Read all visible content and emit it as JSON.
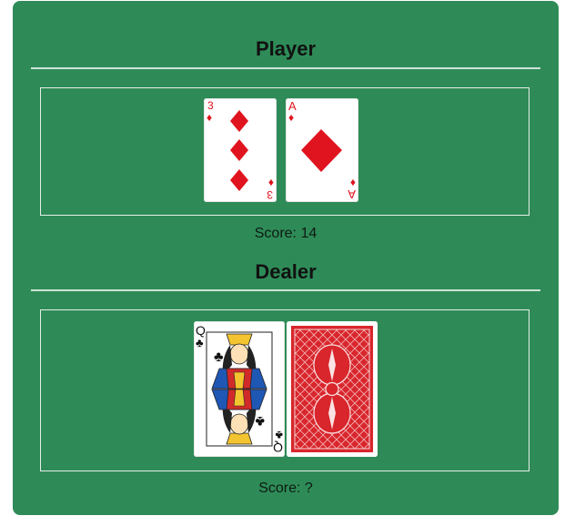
{
  "player": {
    "title": "Player",
    "score_label": "Score: 14",
    "cards": [
      {
        "rank": "3",
        "suit": "diamonds",
        "suit_symbol": "♦",
        "color": "#e0141e"
      },
      {
        "rank": "A",
        "suit": "diamonds",
        "suit_symbol": "♦",
        "color": "#e0141e"
      }
    ]
  },
  "dealer": {
    "title": "Dealer",
    "score_label": "Score: ?",
    "cards": [
      {
        "rank": "Q",
        "suit": "clubs",
        "suit_symbol": "♣",
        "color": "#111111"
      },
      {
        "face_down": true,
        "back_color": "#d8262c"
      }
    ]
  },
  "colors": {
    "table": "#2e8b57",
    "red_suit": "#e0141e"
  }
}
